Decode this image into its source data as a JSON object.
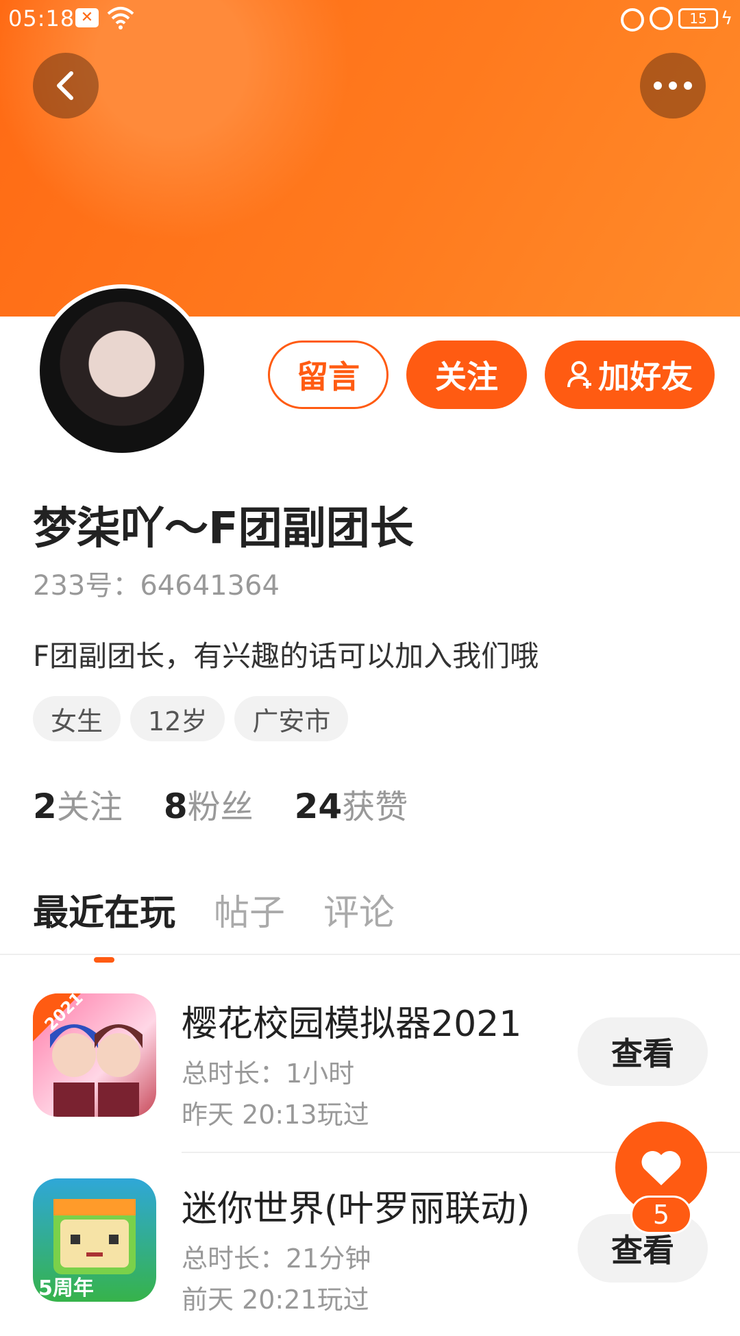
{
  "status_bar": {
    "time": "05:18",
    "battery": "15"
  },
  "profile": {
    "name": "梦柒吖～F团副团长",
    "uid": "233号：64641364",
    "bio": "F团副团长，有兴趣的话可以加入我们哦",
    "tags": [
      "女生",
      "12岁",
      "广安市"
    ],
    "stats": [
      {
        "num": "2",
        "label": "关注"
      },
      {
        "num": "8",
        "label": "粉丝"
      },
      {
        "num": "24",
        "label": "获赞"
      }
    ]
  },
  "actions": {
    "message": "留言",
    "follow": "关注",
    "add_friend": "加好友"
  },
  "tabs": [
    {
      "label": "最近在玩",
      "active": true
    },
    {
      "label": "帖子",
      "active": false
    },
    {
      "label": "评论",
      "active": false
    }
  ],
  "games": [
    {
      "title": "樱花校园模拟器2021",
      "duration": "总时长：1小时",
      "last_played": "昨天 20:13玩过",
      "view_label": "查看",
      "icon": "sakura-school-icon",
      "badge": "2021"
    },
    {
      "title": "迷你世界(叶罗丽联动)",
      "duration": "总时长：21分钟",
      "last_played": "前天 20:21玩过",
      "view_label": "查看",
      "icon": "mini-world-icon",
      "badge": "5周年"
    }
  ],
  "like": {
    "count": "5"
  },
  "colors": {
    "accent": "#ff5b12",
    "banner": "#ff7a1e"
  }
}
